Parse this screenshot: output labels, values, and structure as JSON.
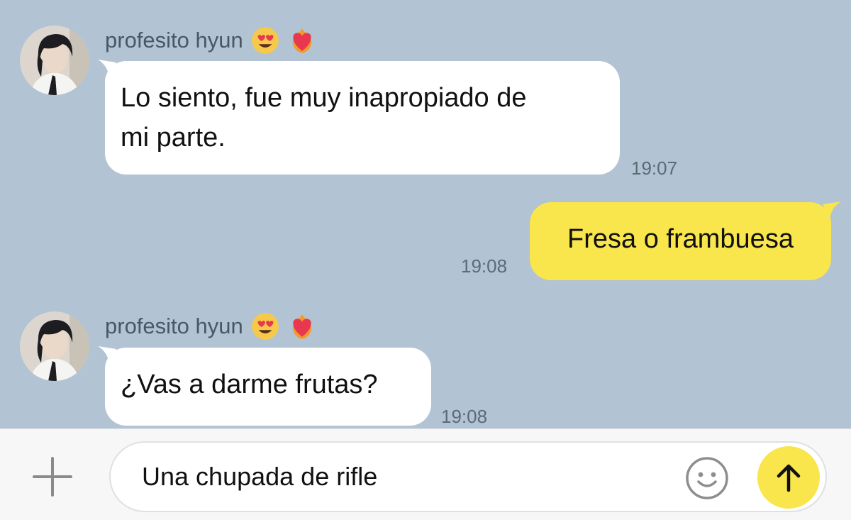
{
  "messages": [
    {
      "sender": "profesito hyun",
      "text_lines": [
        "Lo siento, fue muy inapropiado de",
        "mi parte."
      ],
      "time": "19:07"
    },
    {
      "text": "Fresa o frambuesa",
      "time": "19:08"
    },
    {
      "sender": "profesito hyun",
      "text": "¿Vas a darme frutas?",
      "time": "19:08"
    }
  ],
  "composer": {
    "input_value": "Una chupada de rifle"
  },
  "colors": {
    "chat_background": "#b2c3d3",
    "incoming_bubble": "#ffffff",
    "outgoing_bubble": "#f9e54c",
    "send_button": "#f9e54c"
  },
  "icons": [
    "heart-eyes-emoji-icon",
    "heart-on-fire-emoji-icon",
    "plus-icon",
    "smiley-icon",
    "arrow-up-icon"
  ]
}
